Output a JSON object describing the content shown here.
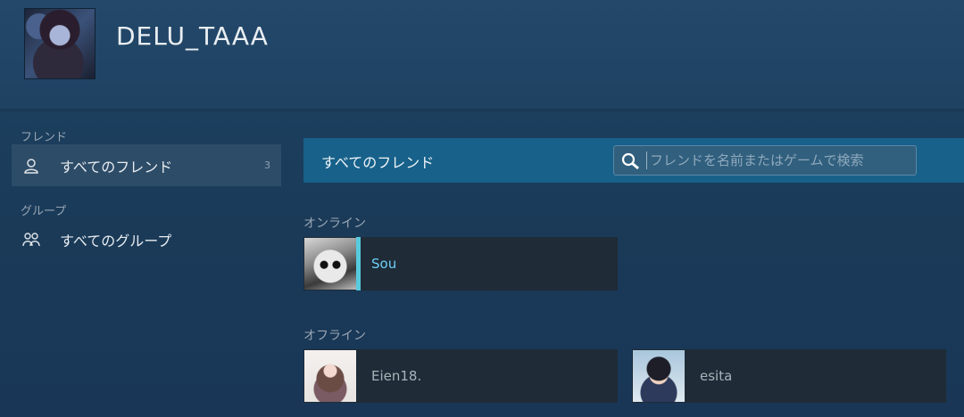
{
  "profile": {
    "username": "DELU_TAAA"
  },
  "sidebar": {
    "friends_section": "フレンド",
    "all_friends_label": "すべてのフレンド",
    "all_friends_count": "3",
    "groups_section": "グループ",
    "all_groups_label": "すべてのグループ"
  },
  "main": {
    "title": "すべてのフレンド",
    "search_placeholder": "フレンドを名前またはゲームで検索",
    "online_label": "オンライン",
    "offline_label": "オフライン",
    "online_friends": [
      {
        "name": "Sou"
      }
    ],
    "offline_friends": [
      {
        "name": "Eien18."
      },
      {
        "name": "esita"
      }
    ]
  },
  "colors": {
    "accent_online": "#57cbde",
    "topbar": "#17618a"
  }
}
